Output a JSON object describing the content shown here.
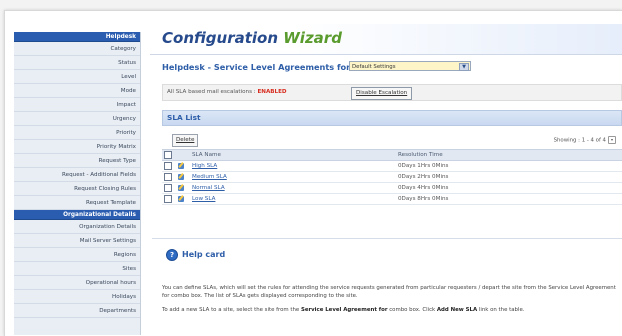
{
  "sidebar": {
    "group1": {
      "header": "Helpdesk",
      "items": [
        "Category",
        "Status",
        "Level",
        "Mode",
        "Impact",
        "Urgency",
        "Priority",
        "Priority Matrix",
        "Request Type",
        "Request - Additional Fields",
        "Request Closing Rules",
        "Request Template"
      ]
    },
    "group2": {
      "header": "Organizational Details",
      "items": [
        "Organization Details",
        "Mail Server Settings",
        "Regions",
        "Sites",
        "Operational hours",
        "Holidays",
        "Departments"
      ]
    }
  },
  "page": {
    "title_part1": "Configuration",
    "title_part2": "Wizard",
    "sla_header": "Helpdesk - Service Level Agreements for",
    "settings_select_value": "Default Settings",
    "escalation_label": "All SLA based mail escalations : ",
    "escalation_status": "ENABLED",
    "disable_escalation_label": "Disable Escalation",
    "sla_list_title": "SLA List",
    "delete_label": "Delete",
    "showing_text": "Showing : 1 - 4 of 4"
  },
  "table": {
    "headers": [
      "SLA Name",
      "Resolution Time"
    ],
    "rows": [
      {
        "name": "High SLA",
        "time": "0Days 1Hrs 0Mins"
      },
      {
        "name": "Medium SLA",
        "time": "0Days 2Hrs 0Mins"
      },
      {
        "name": "Normal SLA",
        "time": "0Days 4Hrs 0Mins"
      },
      {
        "name": "Low SLA",
        "time": "0Days 8Hrs 0Mins"
      }
    ]
  },
  "help": {
    "title": "Help card",
    "text1": "You can define SLAs, which will set the rules for attending the service requests generated from particular requesters / depart the site from the Service Level Agreement for combo box. The list of SLAs gets displayed corresponding to the site.",
    "text2_a": "To add a new SLA to a site, select the site from the ",
    "text2_b": "Service Level Agreement for",
    "text2_c": " combo box. Click ",
    "text2_d": "Add New SLA",
    "text2_e": " link on the table."
  },
  "colors": {
    "accent_blue": "#2a5db0",
    "title_green": "#5a9b2e",
    "enabled_red": "#d72b1e"
  },
  "icons": [
    "edit-icon",
    "help-icon",
    "chevron-down-icon"
  ]
}
